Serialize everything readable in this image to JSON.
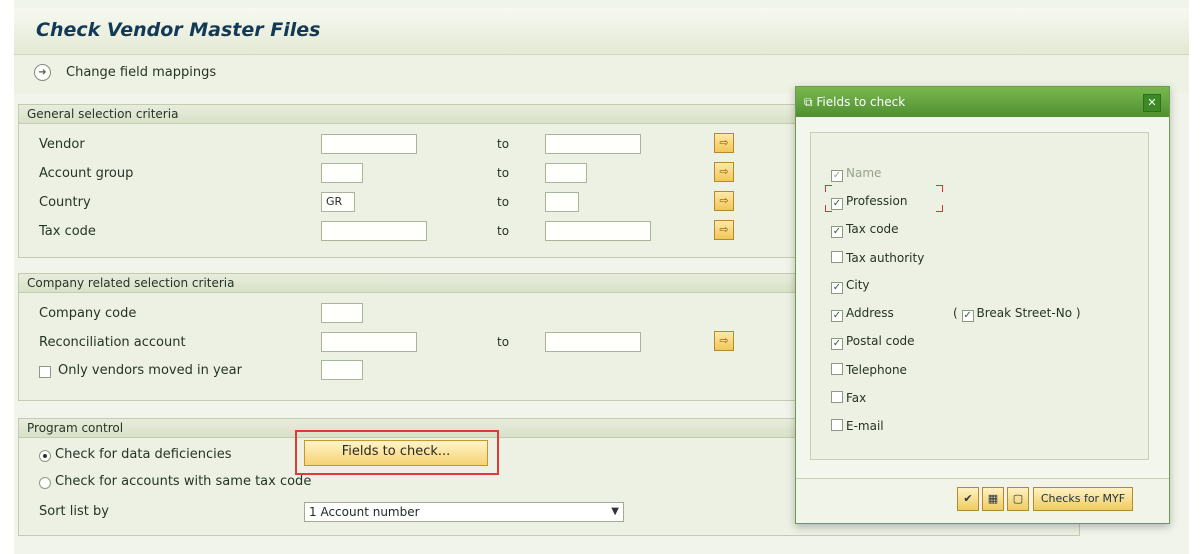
{
  "title": "Check Vendor Master Files",
  "toolbar": {
    "change_field_mappings": "Change field mappings"
  },
  "general": {
    "header": "General selection criteria",
    "rows": [
      {
        "label": "Vendor",
        "value": "",
        "to": "to"
      },
      {
        "label": "Account group",
        "value": "",
        "to": "to"
      },
      {
        "label": "Country",
        "value": "GR",
        "to": "to"
      },
      {
        "label": "Tax code",
        "value": "",
        "to": "to"
      }
    ]
  },
  "company": {
    "header": "Company related selection criteria",
    "company_code": "Company code",
    "reconciliation": "Reconciliation account",
    "to": "to",
    "only_moved": "Only vendors moved in year"
  },
  "program": {
    "header": "Program control",
    "check_deficiencies": "Check for data deficiencies",
    "fields_button": "Fields to check...",
    "same_tax": "Check for accounts with same tax code",
    "sort_label": "Sort list by",
    "sort_value": "1 Account number"
  },
  "dialog": {
    "title": "Fields to check",
    "items": [
      {
        "label": "Name",
        "checked": true,
        "disabled": true
      },
      {
        "label": "Profession",
        "checked": true
      },
      {
        "label": "Tax code",
        "checked": true
      },
      {
        "label": "Tax authority",
        "checked": false
      },
      {
        "label": "City",
        "checked": true
      },
      {
        "label": "Address",
        "checked": true
      },
      {
        "label": "Postal code",
        "checked": true
      },
      {
        "label": "Telephone",
        "checked": false
      },
      {
        "label": "Fax",
        "checked": false
      },
      {
        "label": "E-mail",
        "checked": false
      }
    ],
    "break_open": "(",
    "break_label": "Break Street-No",
    "break_close": ")",
    "footer_button": "Checks for MYF"
  }
}
